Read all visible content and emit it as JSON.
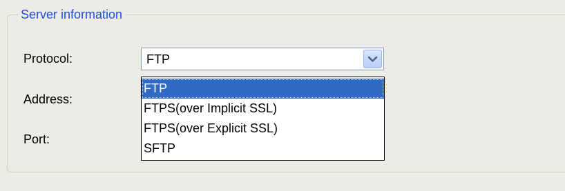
{
  "groupbox": {
    "title": "Server information"
  },
  "protocol": {
    "label": "Protocol:",
    "selected": "FTP",
    "options": [
      "FTP",
      "FTPS(over Implicit SSL)",
      "FTPS(over Explicit SSL)",
      "SFTP"
    ],
    "highlighted_index": 0
  },
  "address": {
    "label": "Address:"
  },
  "port": {
    "label": "Port:"
  },
  "icons": {
    "dropdown": "chevron-down-icon"
  },
  "colors": {
    "legend_text": "#1f4fe0",
    "selection_bg": "#316ac5",
    "panel_bg": "#ecebe6"
  }
}
